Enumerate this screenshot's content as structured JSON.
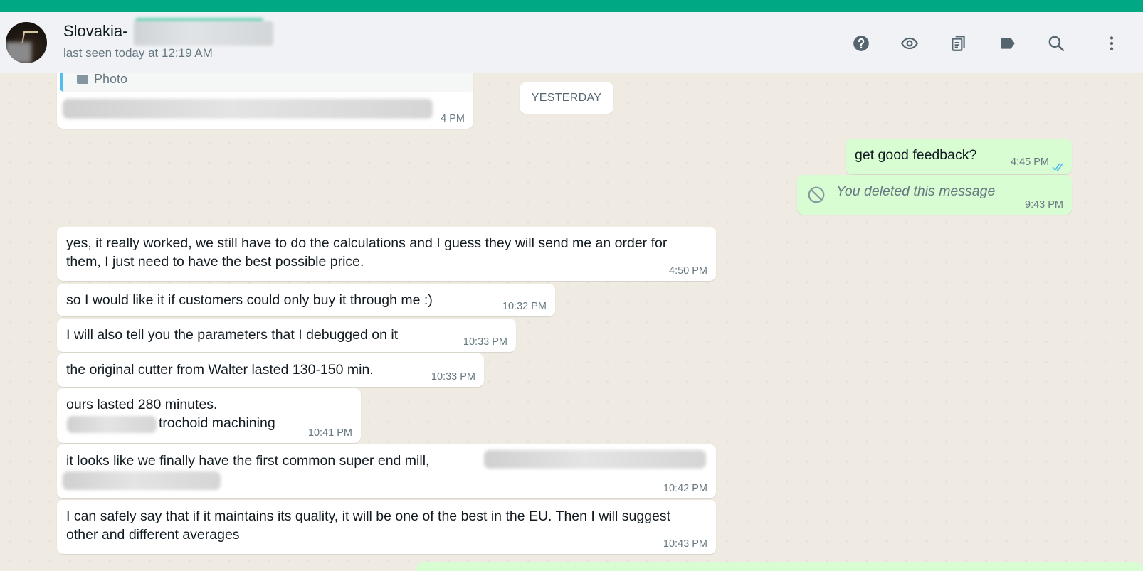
{
  "header": {
    "contact_name": "Slovakia-",
    "last_seen": "last seen today at 12:19 AM",
    "icons": [
      "help-icon",
      "eye-icon",
      "clipboard-icon",
      "label-icon",
      "search-icon",
      "menu-dots-icon"
    ]
  },
  "colors": {
    "accent": "#00a884",
    "incoming_bubble": "#ffffff",
    "outgoing_bubble": "#d9fdd3",
    "chat_bg": "#efeae2",
    "read_tick": "#53bdeb"
  },
  "chat": {
    "date_separator": "YESTERDAY",
    "quoted_message": {
      "label": "Photo",
      "time": "4 PM"
    },
    "messages": [
      {
        "dir": "out",
        "text": "get good feedback?",
        "time": "4:45 PM",
        "status": "read"
      },
      {
        "dir": "out",
        "text": "You deleted this message",
        "time": "9:43 PM",
        "deleted": true
      },
      {
        "dir": "in",
        "text": "yes, it really worked, we still have to do the calculations and I guess they will send me an order for them, I just need to have the best possible price.",
        "time": "4:50 PM"
      },
      {
        "dir": "in",
        "text": "so I would like it if customers could only buy it through me :)",
        "time": "10:32 PM"
      },
      {
        "dir": "in",
        "text": "I will also tell you the parameters that I debugged on it",
        "time": "10:33 PM"
      },
      {
        "dir": "in",
        "text": "the original cutter from Walter lasted 130-150 min.",
        "time": "10:33 PM"
      },
      {
        "dir": "in",
        "text": "ours lasted 280 minutes.",
        "text2": "trochoid machining",
        "time": "10:41 PM"
      },
      {
        "dir": "in",
        "text": "it looks like we finally have the first common super end mill,",
        "time": "10:42 PM"
      },
      {
        "dir": "in",
        "text": "I can safely say that if it maintains its quality, it will be one of the best in the EU. Then I will suggest other and different averages",
        "time": "10:43 PM"
      }
    ]
  }
}
